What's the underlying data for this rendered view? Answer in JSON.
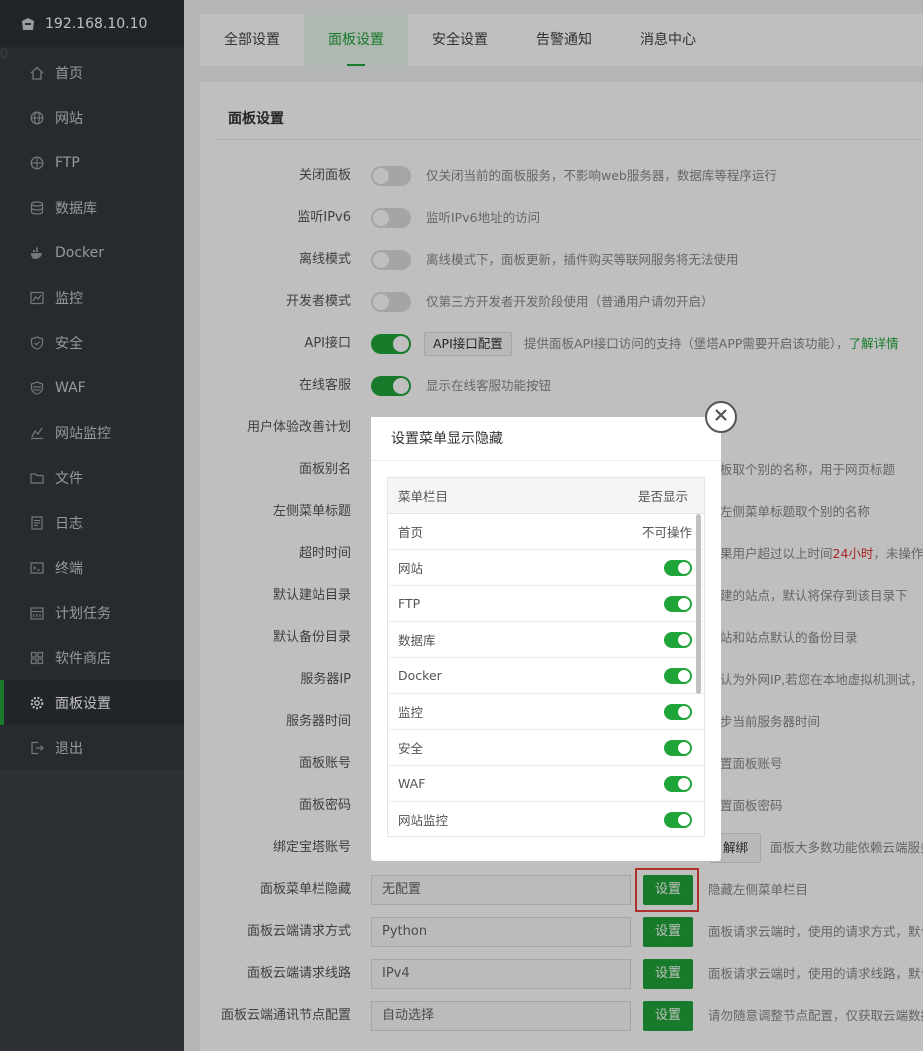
{
  "sidebar": {
    "server": "192.168.10.10",
    "badge": "0",
    "items": [
      {
        "label": "首页",
        "icon": "home-icon"
      },
      {
        "label": "网站",
        "icon": "globe-icon"
      },
      {
        "label": "FTP",
        "icon": "ftp-icon"
      },
      {
        "label": "数据库",
        "icon": "database-icon"
      },
      {
        "label": "Docker",
        "icon": "docker-icon"
      },
      {
        "label": "监控",
        "icon": "monitor-icon"
      },
      {
        "label": "安全",
        "icon": "shield-icon"
      },
      {
        "label": "WAF",
        "icon": "waf-icon"
      },
      {
        "label": "网站监控",
        "icon": "site-monitor-icon"
      },
      {
        "label": "文件",
        "icon": "folder-icon"
      },
      {
        "label": "日志",
        "icon": "log-icon"
      },
      {
        "label": "终端",
        "icon": "terminal-icon"
      },
      {
        "label": "计划任务",
        "icon": "calendar-icon"
      },
      {
        "label": "软件商店",
        "icon": "store-icon"
      },
      {
        "label": "面板设置",
        "icon": "gear-icon"
      },
      {
        "label": "退出",
        "icon": "logout-icon"
      }
    ]
  },
  "tabs": [
    "全部设置",
    "面板设置",
    "安全设置",
    "告警通知",
    "消息中心"
  ],
  "panel": {
    "title": "面板设置",
    "rows": {
      "close_panel": {
        "label": "关闭面板",
        "desc": "仅关闭当前的面板服务，不影响web服务器，数据库等程序运行"
      },
      "ipv6": {
        "label": "监听IPv6",
        "desc": "监听IPv6地址的访问"
      },
      "offline": {
        "label": "离线模式",
        "desc": "离线模式下，面板更新，插件购买等联网服务将无法使用"
      },
      "developer": {
        "label": "开发者模式",
        "desc": "仅第三方开发者开发阶段使用（普通用户请勿开启）"
      },
      "api": {
        "label": "API接口",
        "button": "API接口配置",
        "desc": "提供面板API接口访问的支持（堡塔APP需要开启该功能），",
        "link": "了解详情"
      },
      "online_service": {
        "label": "在线客服",
        "desc": "显示在线客服功能按钮"
      },
      "ux_plan": {
        "label": "用户体验改善计划"
      },
      "alias": {
        "label": "面板别名",
        "desc": "板取个别的名称，用于网页标题"
      },
      "menu_title": {
        "label": "左侧菜单标题",
        "desc": "左侧菜单标题取个别的名称"
      },
      "timeout": {
        "label": "超时时间",
        "desc_a": "果用户超过以上时间",
        "desc_red": "24小时",
        "desc_b": "，未操作面"
      },
      "site_dir": {
        "label": "默认建站目录",
        "desc": "建的站点，默认将保存到该目录下"
      },
      "backup_dir": {
        "label": "默认备份目录",
        "desc": "站和站点默认的备份目录"
      },
      "server_ip": {
        "label": "服务器IP",
        "desc": "认为外网IP,若您在本地虚拟机测试，请"
      },
      "server_time": {
        "label": "服务器时间",
        "desc": "步当前服务器时间"
      },
      "account": {
        "label": "面板账号",
        "desc": "置面板账号"
      },
      "password": {
        "label": "面板密码",
        "desc": "置面板密码"
      },
      "bind": {
        "label": "绑定宝塔账号",
        "button": "解绑",
        "desc": "面板大多数功能依赖云端服务"
      },
      "menu_hide": {
        "label": "面板菜单栏隐藏",
        "value": "无配置",
        "button": "设置",
        "desc": "隐藏左侧菜单栏目"
      },
      "cloud_method": {
        "label": "面板云端请求方式",
        "value": "Python",
        "button": "设置",
        "desc": "面板请求云端时，使用的请求方式，默认"
      },
      "cloud_line": {
        "label": "面板云端请求线路",
        "value": "IPv4",
        "button": "设置",
        "desc": "面板请求云端时，使用的请求线路，默认"
      },
      "cloud_node": {
        "label": "面板云端通讯节点配置",
        "value": "自动选择",
        "button": "设置",
        "desc": "请勿随意调整节点配置，仅获取云端数据"
      }
    }
  },
  "modal": {
    "title": "设置菜单显示隐藏",
    "col_name": "菜单栏目",
    "col_show": "是否显示",
    "rows": [
      {
        "name": "首页",
        "state": "不可操作"
      },
      {
        "name": "网站"
      },
      {
        "name": "FTP"
      },
      {
        "name": "数据库"
      },
      {
        "name": "Docker"
      },
      {
        "name": "监控"
      },
      {
        "name": "安全"
      },
      {
        "name": "WAF"
      },
      {
        "name": "网站监控"
      }
    ]
  }
}
